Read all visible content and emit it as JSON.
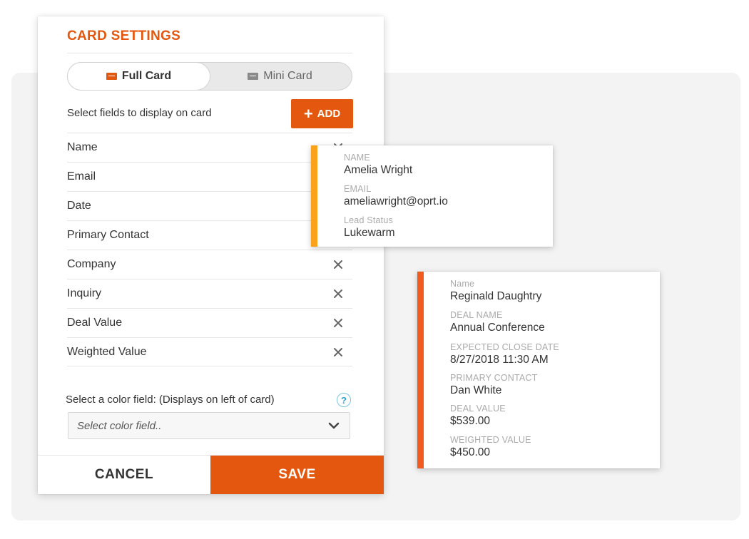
{
  "panel": {
    "title": "CARD SETTINGS",
    "toggle": {
      "full_label": "Full Card",
      "mini_label": "Mini Card",
      "selected": "Full Card"
    },
    "fields_label": "Select fields to display on card",
    "add_label": "ADD",
    "fields": [
      "Name",
      "Email",
      "Date",
      "Primary Contact",
      "Company",
      "Inquiry",
      "Deal Value",
      "Weighted Value"
    ],
    "color_label": "Select a color field: (Displays on left of card)",
    "color_placeholder": "Select color field..",
    "help_glyph": "?",
    "cancel_label": "CANCEL",
    "save_label": "SAVE"
  },
  "cards": [
    {
      "accent": "#f9a21a",
      "fields": [
        {
          "label": "NAME",
          "value": "Amelia Wright"
        },
        {
          "label": "EMAIL",
          "value": "ameliawright@oprt.io"
        },
        {
          "label": "Lead Status",
          "value": "Lukewarm"
        }
      ]
    },
    {
      "accent": "#f25a1f",
      "fields": [
        {
          "label": "Name",
          "value": "Reginald Daughtry"
        },
        {
          "label": "DEAL NAME",
          "value": "Annual Conference"
        },
        {
          "label": "EXPECTED CLOSE DATE",
          "value": "8/27/2018 11:30 AM"
        },
        {
          "label": "PRIMARY CONTACT",
          "value": "Dan White"
        },
        {
          "label": "DEAL VALUE",
          "value": "$539.00"
        },
        {
          "label": "WEIGHTED VALUE",
          "value": "$450.00"
        }
      ]
    }
  ],
  "colors": {
    "brand": "#e4570f",
    "accent_yellow": "#f9a21a",
    "accent_orange": "#f25a1f",
    "help": "#29a3cc"
  },
  "icons": {
    "remove": "close-icon",
    "add": "plus-icon",
    "full_card": "card-icon",
    "mini_card": "mini-card-icon",
    "dropdown": "chevron-down-icon",
    "help": "help-icon"
  }
}
